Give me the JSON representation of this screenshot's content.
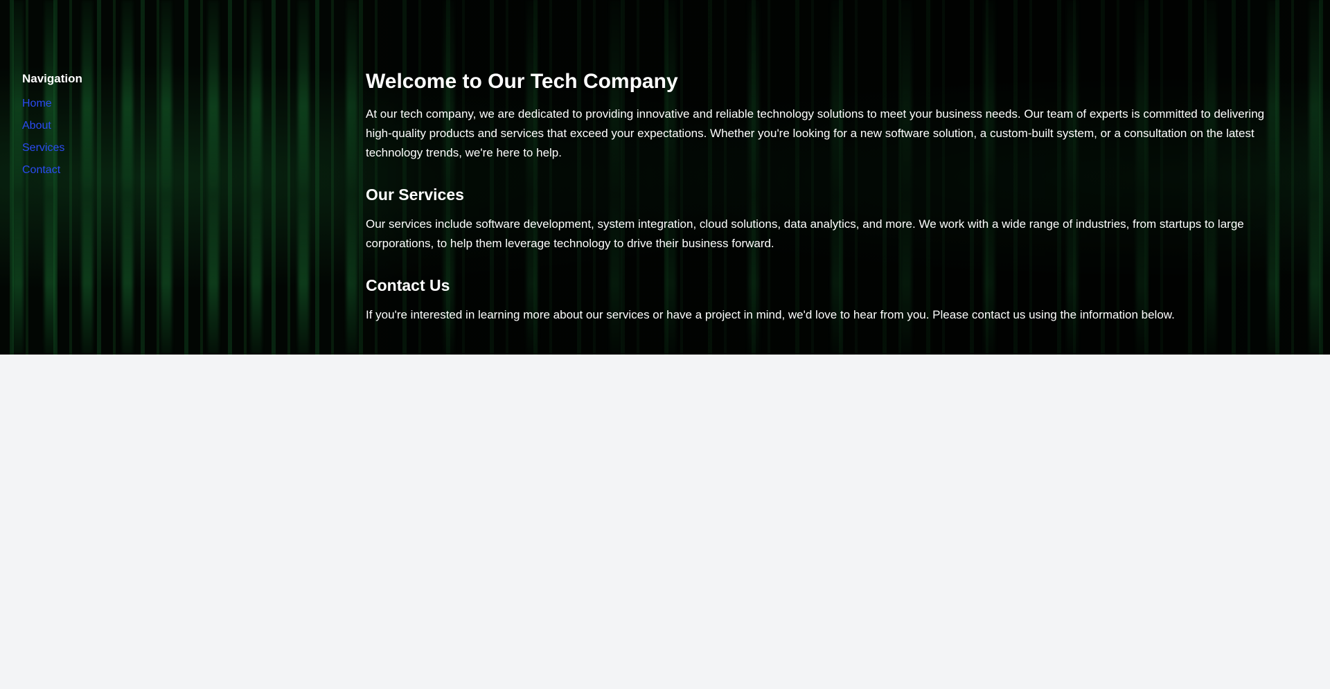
{
  "sidebar": {
    "title": "Navigation",
    "links": [
      {
        "label": "Home"
      },
      {
        "label": "About"
      },
      {
        "label": "Services"
      },
      {
        "label": "Contact"
      }
    ],
    "link_color": "#2b4bf2"
  },
  "main": {
    "heading": "Welcome to Our Tech Company",
    "intro": "At our tech company, we are dedicated to providing innovative and reliable technology solutions to meet your business needs. Our team of experts is committed to delivering high-quality products and services that exceed your expectations. Whether you're looking for a new software solution, a custom-built system, or a consultation on the latest technology trends, we're here to help.",
    "services_heading": "Our Services",
    "services_text": "Our services include software development, system integration, cloud solutions, data analytics, and more. We work with a wide range of industries, from startups to large corporations, to help them leverage technology to drive their business forward.",
    "contact_heading": "Contact Us",
    "contact_text": "If you're interested in learning more about our services or have a project in mind, we'd love to hear from you. Please contact us using the information below."
  },
  "colors": {
    "page_background": "#f3f4f6",
    "hero_background": "#000000",
    "matrix_green": "#28b450",
    "text": "#ffffff"
  }
}
